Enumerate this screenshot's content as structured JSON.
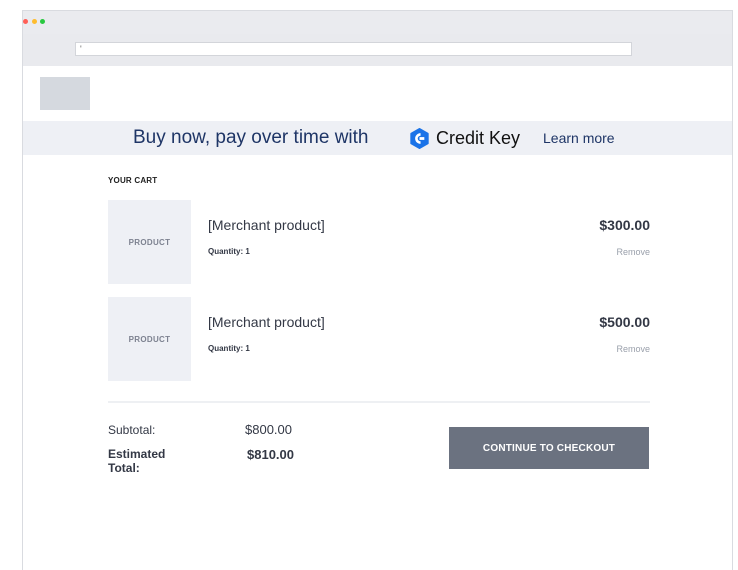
{
  "browser": {
    "address_value": "'"
  },
  "promo": {
    "text": "Buy now, pay over time with",
    "brand_name": "Credit Key",
    "learn_more": "Learn more",
    "brand_color": "#1a73e8"
  },
  "cart": {
    "heading": "YOUR CART",
    "items": [
      {
        "thumbnail_label": "PRODUCT",
        "name": "[Merchant product]",
        "quantity": "Quantity: 1",
        "price": "$300.00",
        "remove_label": "Remove"
      },
      {
        "thumbnail_label": "PRODUCT",
        "name": "[Merchant product]",
        "quantity": "Quantity: 1",
        "price": "$500.00",
        "remove_label": "Remove"
      }
    ]
  },
  "summary": {
    "subtotal_label": "Subtotal:",
    "subtotal_value": "$800.00",
    "total_label": "Estimated Total:",
    "total_value": "$810.00"
  },
  "checkout": {
    "button_label": "CONTINUE TO CHECKOUT",
    "button_color": "#6b7280"
  }
}
